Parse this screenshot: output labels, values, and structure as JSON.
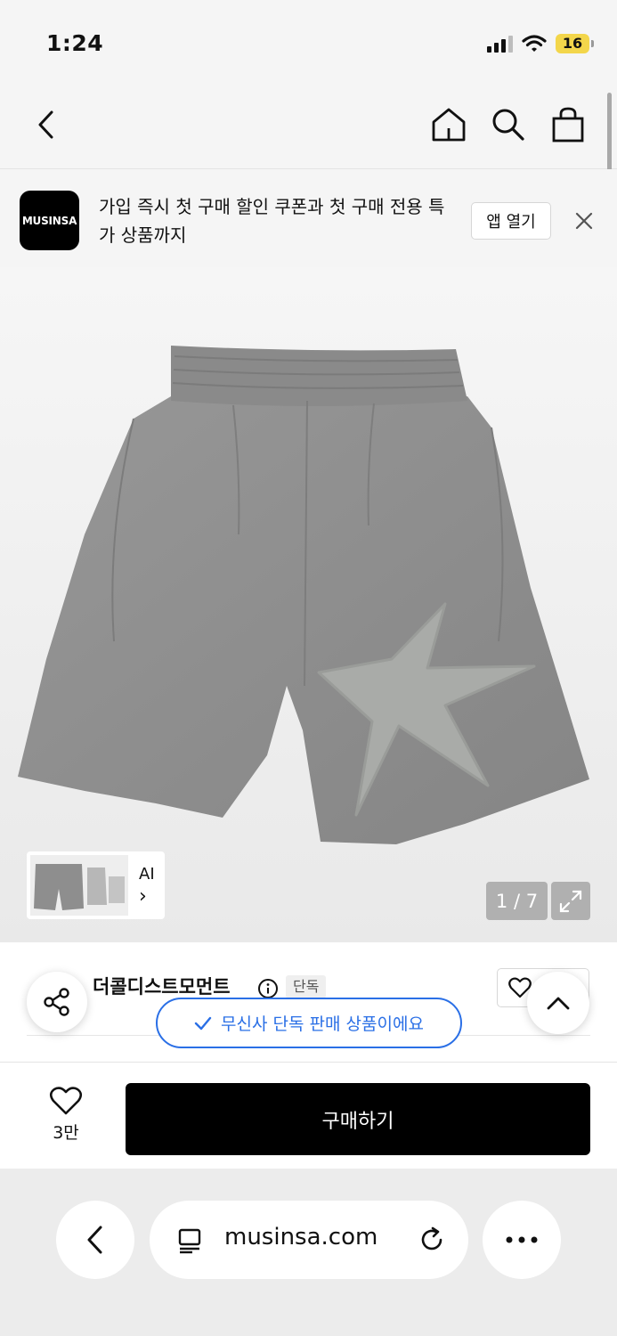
{
  "status_bar": {
    "time": "1:24",
    "battery": "16"
  },
  "app_banner": {
    "logo_text": "MUSINSA",
    "message": "가입 즉시 첫 구매 할인 쿠폰과 첫 구매 전용 특가 상품까지",
    "open_app_label": "앱 열기"
  },
  "gallery": {
    "ai_label": "AI",
    "ai_chevron": "›",
    "page_counter": "1 / 7"
  },
  "product": {
    "brand": "더콜디스트모먼트",
    "badge": "단독"
  },
  "toast": {
    "message": "무신사 단독 판매 상품이에요"
  },
  "purchase": {
    "like_count": "3만",
    "buy_label": "구매하기"
  },
  "browser": {
    "url": "musinsa.com"
  },
  "colors": {
    "accent": "#2a6fe6",
    "battery": "#f3d64b",
    "buy_button": "#000000",
    "shorts": "#8f8f8f",
    "patch": "#a9aba8"
  }
}
